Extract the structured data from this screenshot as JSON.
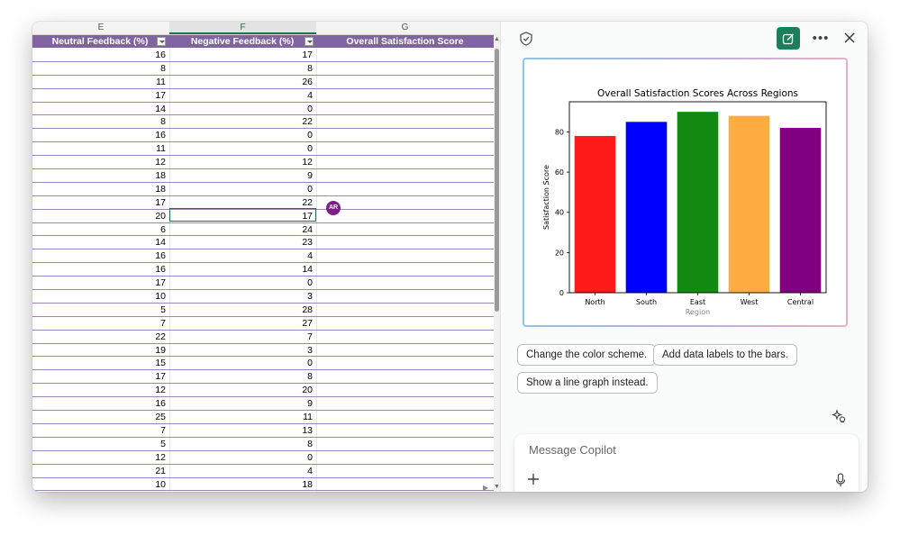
{
  "spreadsheet": {
    "column_letters": [
      "E",
      "F",
      "G"
    ],
    "headers": [
      "Neutral Feedback (%)",
      "Negative Feedback (%)",
      "Overall Satisfaction Score"
    ],
    "rows": [
      [
        "16",
        "17"
      ],
      [
        "8",
        "8"
      ],
      [
        "11",
        "26"
      ],
      [
        "17",
        "4"
      ],
      [
        "14",
        "0"
      ],
      [
        "8",
        "22"
      ],
      [
        "16",
        "0"
      ],
      [
        "11",
        "0"
      ],
      [
        "12",
        "12"
      ],
      [
        "18",
        "9"
      ],
      [
        "18",
        "0"
      ],
      [
        "17",
        "22"
      ],
      [
        "20",
        "17"
      ],
      [
        "6",
        "24"
      ],
      [
        "14",
        "23"
      ],
      [
        "16",
        "4"
      ],
      [
        "16",
        "14"
      ],
      [
        "17",
        "0"
      ],
      [
        "10",
        "3"
      ],
      [
        "5",
        "28"
      ],
      [
        "7",
        "27"
      ],
      [
        "22",
        "7"
      ],
      [
        "19",
        "3"
      ],
      [
        "15",
        "0"
      ],
      [
        "17",
        "8"
      ],
      [
        "12",
        "20"
      ],
      [
        "16",
        "9"
      ],
      [
        "25",
        "11"
      ],
      [
        "7",
        "13"
      ],
      [
        "5",
        "8"
      ],
      [
        "12",
        "0"
      ],
      [
        "21",
        "4"
      ],
      [
        "10",
        "18"
      ]
    ],
    "presence_avatar": "AR",
    "header_color": "#8064a2",
    "accent_color": "#217346"
  },
  "copilot": {
    "icons": [
      "shield-icon",
      "new-chat-icon",
      "more-icon",
      "close-icon",
      "sparkle-icon",
      "plus-icon",
      "mic-icon"
    ],
    "suggestions": [
      "Change the color scheme.",
      "Add data labels to the bars.",
      "Show a line graph instead."
    ],
    "message_placeholder": "Message Copilot",
    "brand_color": "#1d7f5a"
  },
  "chart_data": {
    "type": "bar",
    "title": "Overall Satisfaction Scores Across Regions",
    "xlabel": "Region",
    "ylabel": "Satisfaction Score",
    "categories": [
      "North",
      "South",
      "East",
      "West",
      "Central"
    ],
    "values": [
      78,
      85,
      90,
      88,
      82
    ],
    "colors": [
      "#ff1a1a",
      "#0000ff",
      "#128a12",
      "#ffad40",
      "#800080"
    ],
    "ylim": [
      0,
      95
    ],
    "yticks": [
      0,
      20,
      40,
      60,
      80
    ],
    "grid": false,
    "legend": "none"
  }
}
